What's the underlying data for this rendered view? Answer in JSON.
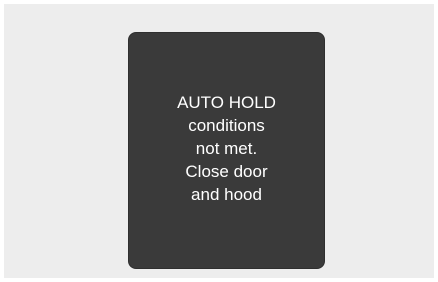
{
  "notification": {
    "lines": [
      "AUTO HOLD",
      "conditions",
      "not met.",
      "Close door",
      "and hood"
    ]
  }
}
